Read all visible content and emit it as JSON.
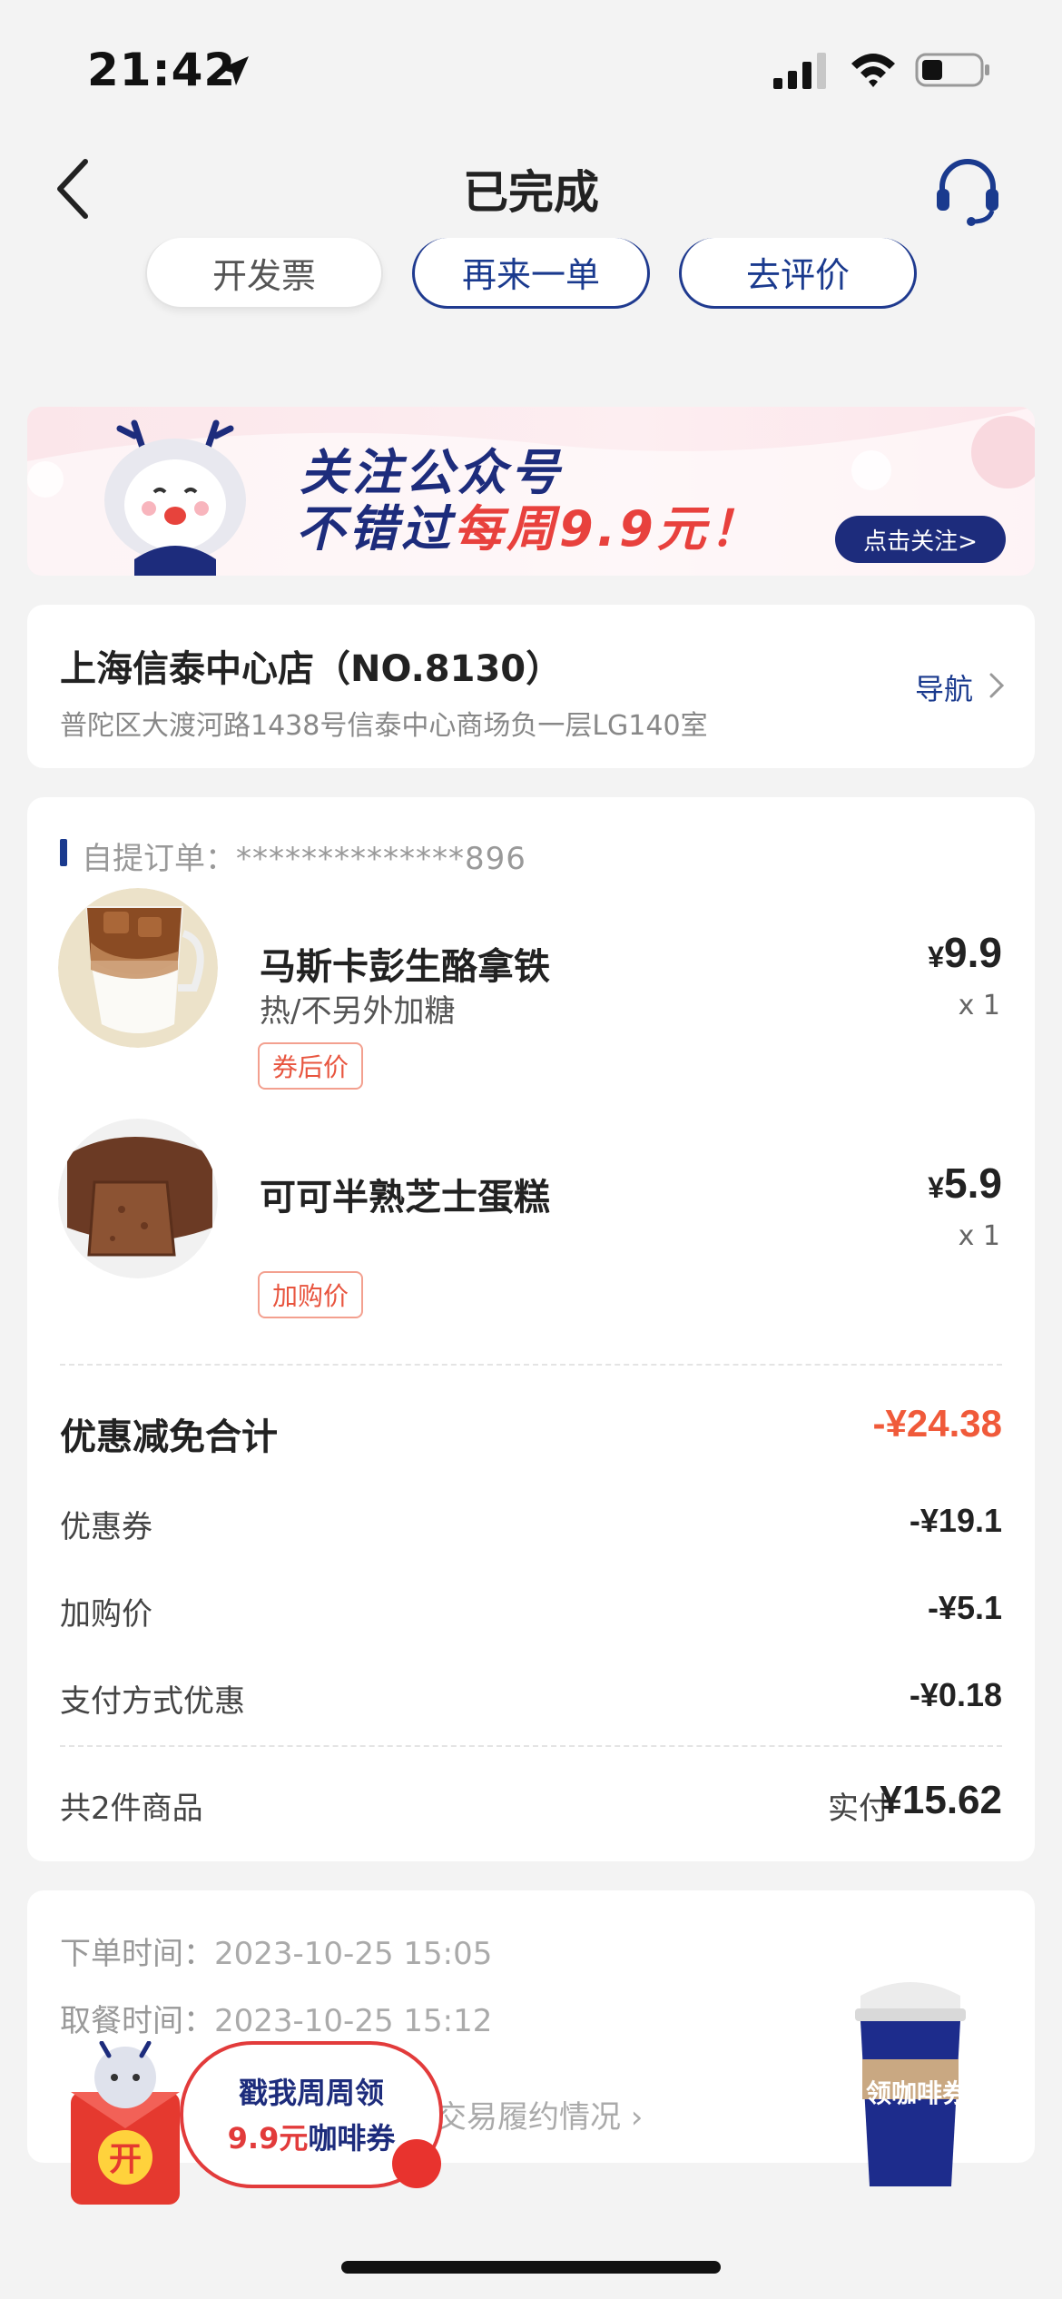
{
  "status_bar": {
    "time": "21:42"
  },
  "nav": {
    "title": "已完成"
  },
  "actions": {
    "invoice": "开发票",
    "reorder": "再来一单",
    "review": "去评价"
  },
  "banner": {
    "line1": "关注公众号",
    "line2_prefix": "不错过",
    "line2_highlight": "每周9.9元！",
    "button": "点击关注>"
  },
  "store": {
    "name": "上海信泰中心店（NO.8130）",
    "address": "普陀区大渡河路1438号信泰中心商场负一层LG140室",
    "nav_label": "导航"
  },
  "order": {
    "label": "自提订单：",
    "number": "**************896",
    "items": [
      {
        "name": "马斯卡彭生酪拿铁",
        "options": "热/不另外加糖",
        "tag": "券后价",
        "currency": "¥",
        "price": "9.9",
        "qty": "x 1"
      },
      {
        "name": "可可半熟芝士蛋糕",
        "options": "",
        "tag": "加购价",
        "currency": "¥",
        "price": "5.9",
        "qty": "x 1"
      }
    ],
    "discount_title": "优惠减免合计",
    "discount_total": "-¥24.38",
    "discounts": [
      {
        "label": "优惠券",
        "value": "-¥19.1"
      },
      {
        "label": "加购价",
        "value": "-¥5.1"
      },
      {
        "label": "支付方式优惠",
        "value": "-¥0.18"
      }
    ],
    "count_label": "共2件商品",
    "paid_label": "实付",
    "paid_amount": "¥15.62"
  },
  "times": {
    "order_label": "下单时间：",
    "order_time": "2023-10-25 15:05",
    "pickup_label": "取餐时间：",
    "pickup_time": "2023-10-25 15:12",
    "trade_link": "交易履约情况"
  },
  "promo": {
    "line1": "戳我周周领",
    "line2_highlight": "9.9元",
    "line2_suffix": "咖啡券",
    "redpacket_char": "开",
    "cup_label": "领咖啡券"
  },
  "colors": {
    "brand_blue": "#1d2c7c",
    "accent_red": "#f05a3a",
    "background": "#f3f3f3"
  }
}
